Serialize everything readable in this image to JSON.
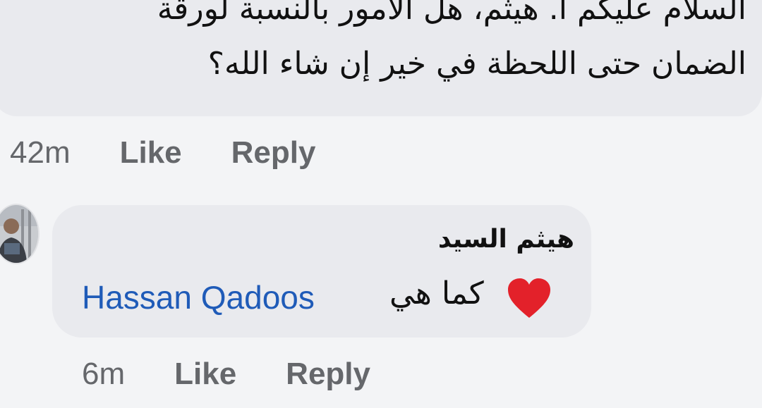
{
  "comment_top": {
    "line1": "السلام عليكم أ. هيثم، هل الأمور بالنسبة لورقة",
    "line2": "الضمان حتى اللحظة في خير إن شاء الله؟",
    "time": "42m",
    "like_label": "Like",
    "reply_label": "Reply"
  },
  "reply_comment": {
    "author": "هيثم السيد",
    "mention": "Hassan Qadoos",
    "text": "كما هي",
    "emoji": "heart-icon",
    "time": "6m",
    "like_label": "Like",
    "reply_label": "Reply",
    "mention_color": "#1f5bb8",
    "heart_color": "#e3212a"
  }
}
